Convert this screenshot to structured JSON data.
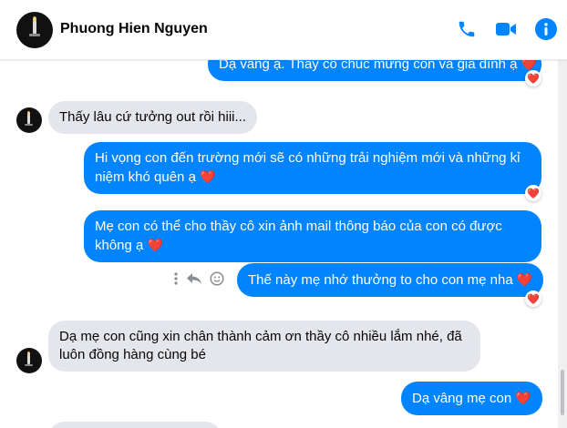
{
  "contact": {
    "name": "Phuong Hien Nguyen"
  },
  "colors": {
    "accent": "#0084ff",
    "heart": "#f02849"
  },
  "header_icons": [
    "phone-icon",
    "video-camera-icon",
    "info-icon"
  ],
  "messages": [
    {
      "dir": "out",
      "text": "Dạ vâng ạ. Thầy cô chúc mừng con và gia đình ạ",
      "heart": "❤️",
      "reaction": "❤️"
    },
    {
      "dir": "in",
      "text": "Thấy lâu cứ tưởng out rồi hiii..."
    },
    {
      "dir": "out",
      "text": "Hi vọng con đến trường mới sẽ có những trải nghiệm mới và những kỉ niệm khó quên ạ",
      "heart": "❤️",
      "reaction": "❤️"
    },
    {
      "dir": "out",
      "text": "Mẹ con có thể cho thầy cô xin ảnh mail thông báo của con có được không ạ",
      "heart": "❤️"
    },
    {
      "dir": "out",
      "text": "Thế này mẹ nhớ thưởng to cho con mẹ nha",
      "heart": "❤️",
      "reaction": "❤️"
    },
    {
      "dir": "in",
      "text": "Dạ mẹ con cũng xin chân thành cảm ơn thầy cô nhiều lắm nhé, đã luôn đồng hàng cùng bé"
    },
    {
      "dir": "out",
      "text": "Dạ vâng mẹ con",
      "heart": "❤️"
    }
  ]
}
